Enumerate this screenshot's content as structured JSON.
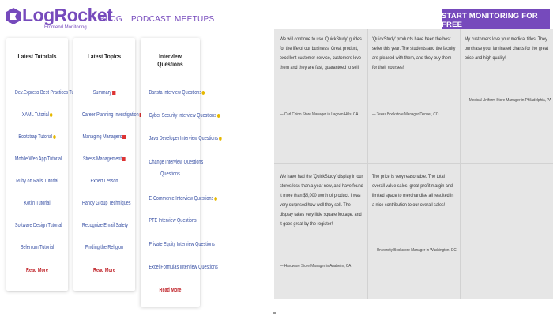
{
  "header": {
    "brand": "LogRocket",
    "tagline": "Frontend Monitoring",
    "nav": [
      "BLOG",
      "PODCAST",
      "MEETUPS"
    ],
    "cta": "START MONITORING FOR FREE",
    "brand_color": "#764abc"
  },
  "cards": [
    {
      "title": "Latest Tutorials",
      "links": [
        {
          "label": "Dev.Express Best Practices Tutorial",
          "badge": "hot"
        },
        {
          "label": "XAML Tutorial",
          "badge": "hot"
        },
        {
          "label": "Bootstrap Tutorial",
          "badge": "hot"
        },
        {
          "label": "Mobile Web App Tutorial",
          "badge": ""
        },
        {
          "label": "Ruby on Rails Tutorial",
          "badge": ""
        },
        {
          "label": "Kotlin Tutorial",
          "badge": ""
        },
        {
          "label": "Software Design Tutorial",
          "badge": ""
        },
        {
          "label": "Selenium Tutorial",
          "badge": ""
        }
      ],
      "more": "Read More"
    },
    {
      "title": "Latest Topics",
      "links": [
        {
          "label": "Summary",
          "badge": "new"
        },
        {
          "label": "Career Planning Investigation",
          "badge": "new"
        },
        {
          "label": "Managing Managers",
          "badge": "new"
        },
        {
          "label": "Stress Management",
          "badge": "new"
        },
        {
          "label": "Expert Lesson",
          "badge": ""
        },
        {
          "label": "Handy Group Techniques",
          "badge": ""
        },
        {
          "label": "Recognize Email Safety",
          "badge": ""
        },
        {
          "label": "Finding the Religion",
          "badge": ""
        }
      ],
      "more": "Read More"
    },
    {
      "title": "Interview Questions",
      "links": [
        {
          "label": "Barista Interview Questions",
          "badge": "hot"
        },
        {
          "label": "Cyber Security Interview Questions",
          "badge": "hot"
        },
        {
          "label": "Java Developer Interview Questions",
          "badge": "hot"
        },
        {
          "label": "Change Interview Questions",
          "badge": ""
        },
        {
          "label": "Questions",
          "badge": ""
        },
        {
          "label": "E-Commerce Interview Questions",
          "badge": "hot"
        },
        {
          "label": "PTE Interview Questions",
          "badge": ""
        },
        {
          "label": "Private Equity Interview Questions",
          "badge": ""
        },
        {
          "label": "Excel Formulas Interview Questions",
          "badge": ""
        }
      ],
      "more": "Read More"
    }
  ],
  "testimonials": [
    {
      "quote": "We will continue to use 'QuickStudy' guides for the life of our business. Great product, excellent customer service, customers love them and they are fast, guaranteed to sell.",
      "attribution": "— Carl Chinn Store Manager in Lagoon Hills, CA"
    },
    {
      "quote": "'QuickStudy' products have been the best seller this year. The students and the faculty are pleased with them, and they buy them for their courses!",
      "attribution": "— Texas Bookstore Manager Denver, CO"
    },
    {
      "quote": "My customers love your medical titles. They purchase your laminated charts for the great price and high quality!",
      "attribution": "— Medical Uniform Store Manager in Philadelphia, PA"
    },
    {
      "quote": "We have had the 'QuickStudy' display in our stores less than a year now, and have found it more than $5,000 worth of product. I was very surprised how well they sell. The display takes very little square footage, and it goes great by the register!",
      "attribution": "— Hardware Store Manager in Anaheim, CA"
    },
    {
      "quote": "The price is very reasonable. The total overall value sales, great profit margin and limited space to merchandise all resulted in a nice contribution to our overall sales!",
      "attribution": "— University Bookstore Manager in Washington, DC"
    }
  ]
}
